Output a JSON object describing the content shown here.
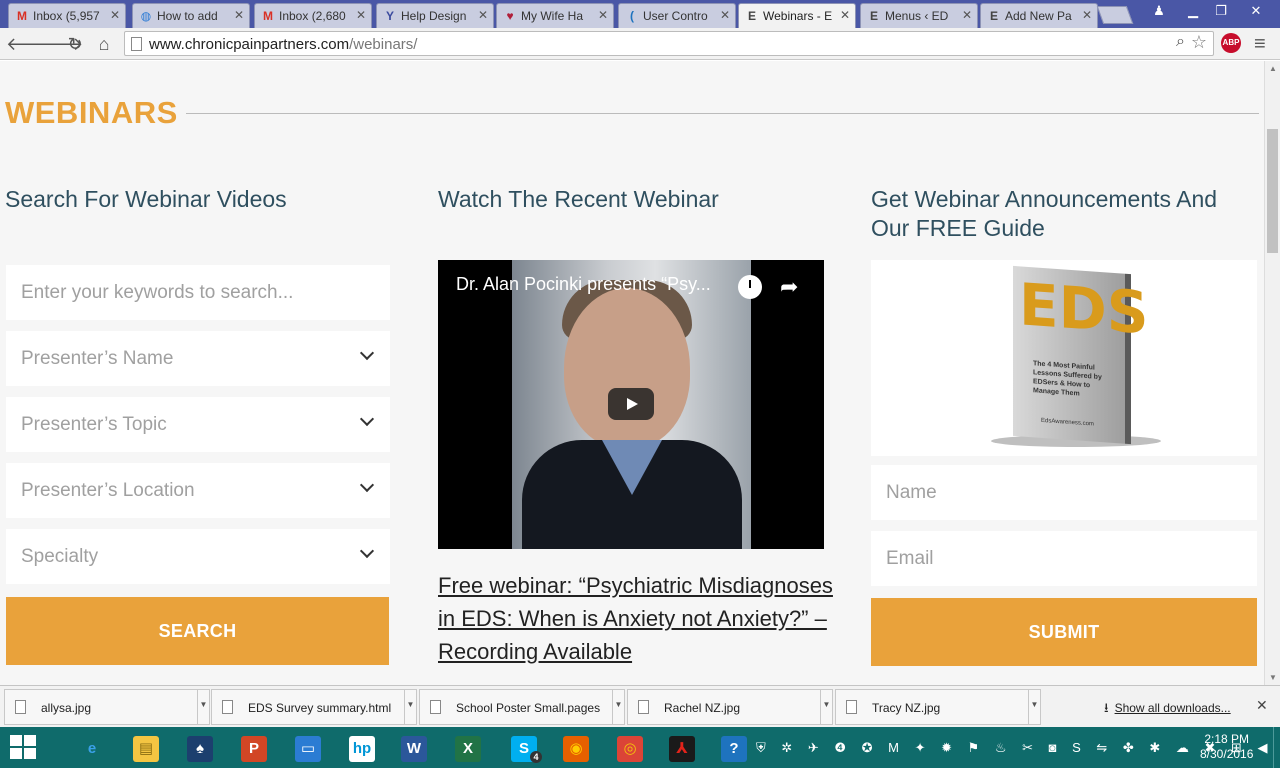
{
  "browser": {
    "tabs": [
      {
        "title": "Inbox (5,957",
        "icon": "gmail-icon",
        "fav": "M",
        "favColor": "#d93025",
        "active": false
      },
      {
        "title": "How to add",
        "icon": "chrome-icon",
        "fav": "◍",
        "favColor": "#2a7ad5",
        "active": false
      },
      {
        "title": "Inbox (2,680",
        "icon": "gmail-icon",
        "fav": "M",
        "favColor": "#d93025",
        "active": false
      },
      {
        "title": "Help Design",
        "icon": "help-icon",
        "fav": "Y",
        "favColor": "#3a4a9e",
        "active": false
      },
      {
        "title": "My Wife Ha",
        "icon": "heart-icon",
        "fav": "♥",
        "favColor": "#b01f3a",
        "active": false
      },
      {
        "title": "User Contro",
        "icon": "wordpress-icon",
        "fav": "(",
        "favColor": "#1e73be",
        "active": false
      },
      {
        "title": "Webinars - E",
        "icon": "eds-icon",
        "fav": "E",
        "favColor": "#444",
        "active": true
      },
      {
        "title": "Menus ‹ ED",
        "icon": "eds-icon",
        "fav": "E",
        "favColor": "#444",
        "active": false
      },
      {
        "title": "Add New Pa",
        "icon": "eds-icon",
        "fav": "E",
        "favColor": "#444",
        "active": false
      }
    ],
    "tab_close": "✕",
    "url_domain": "www.chronicpainpartners.com",
    "url_path": "/webinars/",
    "abp_label": "ABP"
  },
  "page": {
    "title": "WEBINARS",
    "search": {
      "heading": "Search For Webinar Videos",
      "keywords_placeholder": "Enter your keywords to search...",
      "selects": [
        "Presenter’s Name",
        "Presenter’s Topic",
        "Presenter’s Location",
        "Specialty"
      ],
      "button": "SEARCH"
    },
    "recent": {
      "heading": "Watch The Recent Webinar",
      "video_title": "Dr. Alan Pocinki presents “Psy...",
      "link": "Free webinar: “Psychiatric Misdiagnoses in EDS: When is Anxiety not Anxiety?” – Recording Available"
    },
    "signup": {
      "heading": "Get Webinar Announcements And Our FREE Guide",
      "book_title": "EDS",
      "book_subtitle": "The 4 Most Painful Lessons Suffered by EDSers & How to Manage Them",
      "book_site": "EdsAwareness.com",
      "name_placeholder": "Name",
      "email_placeholder": "Email",
      "button": "SUBMIT"
    }
  },
  "downloads": {
    "items": [
      "allysa.jpg",
      "EDS Survey summary.html",
      "School Poster Small.pages",
      "Rachel NZ.jpg",
      "Tracy NZ.jpg"
    ],
    "show_all": "Show all downloads...",
    "close": "✕"
  },
  "taskbar": {
    "apps": [
      {
        "name": "ie-icon",
        "glyph": "e",
        "bg": "transparent",
        "color": "#3aa0e8"
      },
      {
        "name": "file-explorer-icon",
        "glyph": "▤",
        "bg": "#f4c542",
        "color": "#8a6d12"
      },
      {
        "name": "solitaire-icon",
        "glyph": "♠",
        "bg": "#1c3f6e",
        "color": "#fff"
      },
      {
        "name": "powerpoint-icon",
        "glyph": "P",
        "bg": "#d24625",
        "color": "#fff"
      },
      {
        "name": "remote-desktop-icon",
        "glyph": "▭",
        "bg": "#2b7cd3",
        "color": "#fff"
      },
      {
        "name": "hp-icon",
        "glyph": "hp",
        "bg": "#fff",
        "color": "#0096d6"
      },
      {
        "name": "word-icon",
        "glyph": "W",
        "bg": "#2b579a",
        "color": "#fff"
      },
      {
        "name": "excel-icon",
        "glyph": "X",
        "bg": "#217346",
        "color": "#fff"
      },
      {
        "name": "skype-icon",
        "glyph": "S",
        "bg": "#00aff0",
        "color": "#fff"
      },
      {
        "name": "firefox-icon",
        "glyph": "◉",
        "bg": "#e66000",
        "color": "#ffcb00"
      },
      {
        "name": "chrome-app-icon",
        "glyph": "◎",
        "bg": "#db4437",
        "color": "#f4c20d"
      },
      {
        "name": "acrobat-icon",
        "glyph": "⅄",
        "bg": "#1a1a1a",
        "color": "#e2231a"
      },
      {
        "name": "help-app-icon",
        "glyph": "?",
        "bg": "#1e73be",
        "color": "#fff"
      }
    ],
    "skype_badge": "4",
    "tray": "⛨ ✲ ✈ ❹ ✪ M ✦ ✹ ⚑ ♨ ✂ ◙ S ⇋ ✤ ✱ ☁ ✖ ⊞ ◀",
    "time": "2:18 PM",
    "date": "8/30/2016"
  }
}
